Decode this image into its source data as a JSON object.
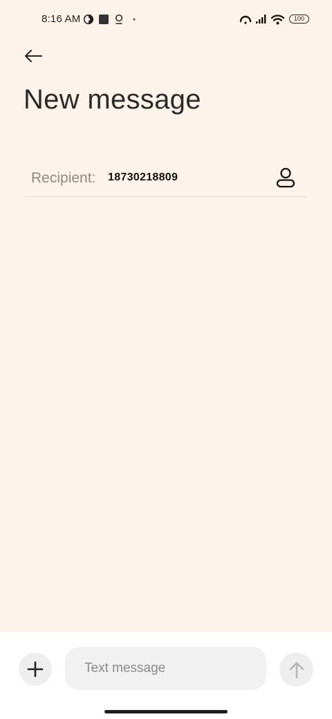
{
  "status_bar": {
    "time": "8:16 AM",
    "battery": "100",
    "icons": [
      "vpn-key-icon",
      "stop-square-icon",
      "location-pin-icon",
      "dot-icon",
      "hotspot-icon",
      "signal-icon",
      "wifi-icon",
      "battery-icon"
    ]
  },
  "header": {
    "back_icon": "arrow-left-icon",
    "title": "New message"
  },
  "recipient": {
    "label": "Recipient:",
    "value": "18730218809",
    "contact_icon": "person-icon"
  },
  "compose": {
    "attach_icon": "plus-icon",
    "placeholder": "Text message",
    "value": "",
    "send_icon": "arrow-up-icon"
  },
  "colors": {
    "background": "#fdf3ea",
    "compose_background": "#ffffff",
    "input_background": "#f1f1f1",
    "button_background": "#eeeeee",
    "send_icon_disabled": "#b5b5b5"
  }
}
